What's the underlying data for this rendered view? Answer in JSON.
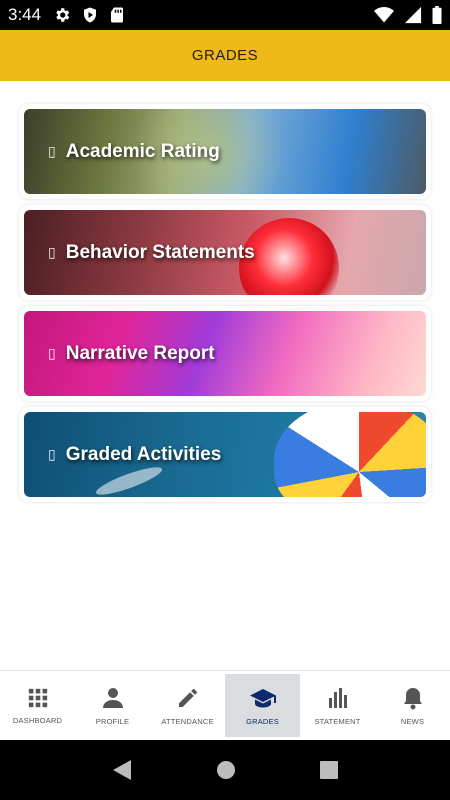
{
  "status_bar": {
    "time": "3:44",
    "icons_left": [
      "gear-icon",
      "play-shield-icon",
      "sd-card-icon"
    ],
    "icons_right": [
      "wifi-icon",
      "signal-icon",
      "battery-icon"
    ]
  },
  "app_bar": {
    "title": "GRADES"
  },
  "cards": [
    {
      "label": "Academic Rating",
      "bullet": "▯"
    },
    {
      "label": "Behavior Statements",
      "bullet": "▯"
    },
    {
      "label": "Narrative Report",
      "bullet": "▯"
    },
    {
      "label": "Graded Activities",
      "bullet": "▯"
    }
  ],
  "bottom_nav": {
    "active": "GRADES",
    "items": [
      {
        "label": "DASHBOARD",
        "icon": "grid-icon"
      },
      {
        "label": "PROFILE",
        "icon": "person-icon"
      },
      {
        "label": "ATTENDANCE",
        "icon": "pencil-icon"
      },
      {
        "label": "GRADES",
        "icon": "graduation-cap-icon"
      },
      {
        "label": "STATEMENT",
        "icon": "bar-chart-icon"
      },
      {
        "label": "NEWS",
        "icon": "bell-icon"
      }
    ]
  },
  "colors": {
    "app_bar": "#efb917",
    "active_nav_bg": "#d9dde0",
    "active_nav_text": "#0f2a6b"
  }
}
